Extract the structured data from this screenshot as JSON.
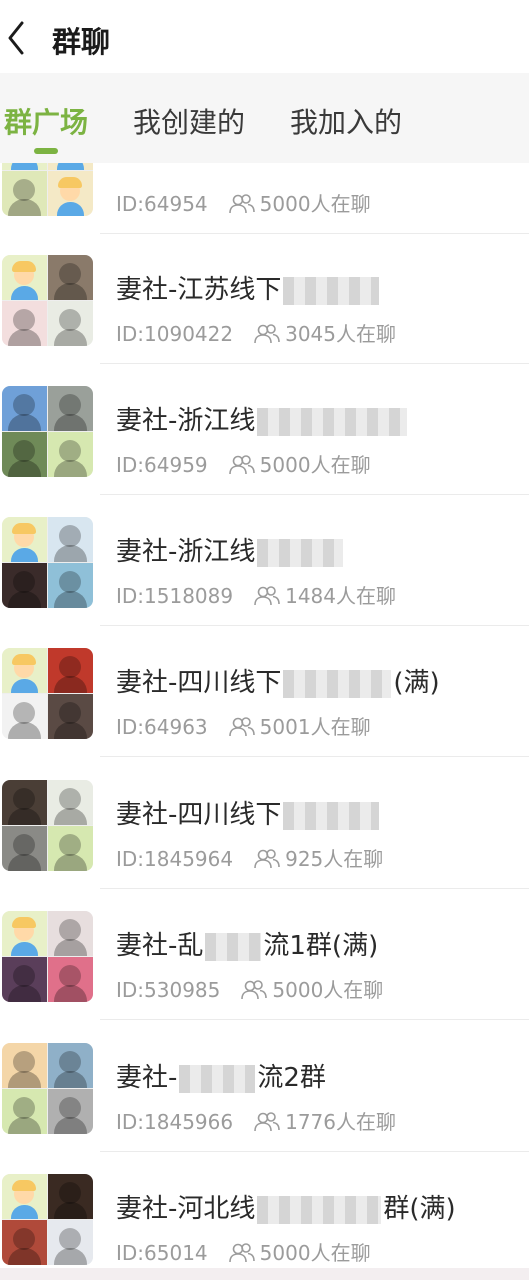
{
  "header": {
    "title": "群聊",
    "back_icon": "chevron-left-icon"
  },
  "tabs": [
    {
      "label": "群广场",
      "active": true
    },
    {
      "label": "我创建的",
      "active": false
    },
    {
      "label": "我加入的",
      "active": false
    }
  ],
  "colors": {
    "accent": "#7cb342",
    "text_primary": "#2a2a2a",
    "text_secondary": "#9b9b9b"
  },
  "groups": [
    {
      "name_prefix": "",
      "name_suffix": "",
      "id": "ID:64954",
      "count": "5000人在聊",
      "tiles": [
        "#e8f0c8",
        "#f4e9c6",
        "#dfe8b8",
        "#f4e9c6"
      ]
    },
    {
      "name_prefix": "妻社-江苏线下",
      "name_suffix": "",
      "id": "ID:1090422",
      "count": "3045人在聊",
      "tiles": [
        "#e8f0c8",
        "#8a7a6a",
        "#f3dede",
        "#e9ece4"
      ]
    },
    {
      "name_prefix": "妻社-浙江线",
      "name_suffix": "",
      "id": "ID:64959",
      "count": "5000人在聊",
      "tiles": [
        "#6fa0d8",
        "#9aa09a",
        "#6f8a58",
        "#d6e8b0"
      ]
    },
    {
      "name_prefix": "妻社-浙江线",
      "name_suffix": "",
      "id": "ID:1518089",
      "count": "1484人在聊",
      "tiles": [
        "#e8f0c8",
        "#d8e6f0",
        "#3a2b2a",
        "#8fc0d8"
      ]
    },
    {
      "name_prefix": "妻社-四川线下",
      "name_suffix": "(满)",
      "id": "ID:64963",
      "count": "5001人在聊",
      "tiles": [
        "#e8f0c8",
        "#c0392b",
        "#f2f2f2",
        "#5a4a44"
      ]
    },
    {
      "name_prefix": "妻社-四川线下",
      "name_suffix": "",
      "id": "ID:1845964",
      "count": "925人在聊",
      "tiles": [
        "#4a3e36",
        "#e9ece4",
        "#8a8a86",
        "#d6e8b0"
      ]
    },
    {
      "name_prefix": "妻社-乱",
      "name_suffix": "流1群(满)",
      "id": "ID:530985",
      "count": "5000人在聊",
      "tiles": [
        "#e8f0c8",
        "#e7dede",
        "#5a3e5a",
        "#e0708a"
      ]
    },
    {
      "name_prefix": "妻社-",
      "name_suffix": "流2群",
      "id": "ID:1845966",
      "count": "1776人在聊",
      "tiles": [
        "#f4d6a8",
        "#8fb0c8",
        "#d6e8b0",
        "#b0b0b0"
      ]
    },
    {
      "name_prefix": "妻社-河北线",
      "name_suffix": "群(满)",
      "id": "ID:65014",
      "count": "5000人在聊",
      "tiles": [
        "#e8f0c8",
        "#3a2a22",
        "#b04a3a",
        "#e6e9ee"
      ]
    }
  ]
}
